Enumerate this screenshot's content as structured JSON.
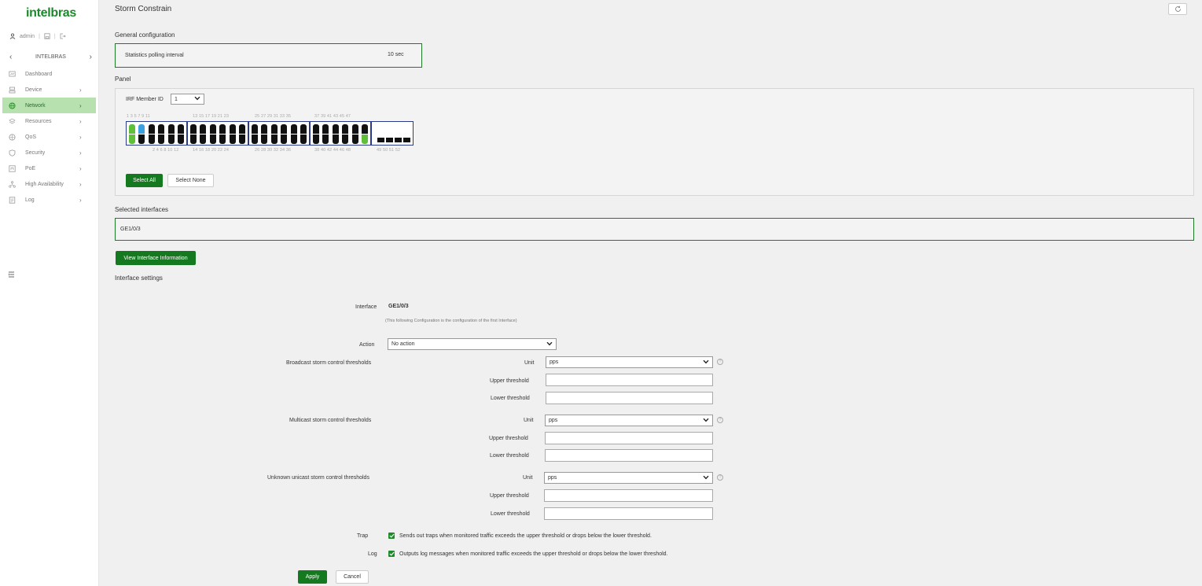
{
  "brand": "intelbras",
  "user": {
    "name": "admin"
  },
  "domain_bar": {
    "left": "‹",
    "label": "INTELBRAS",
    "right": "›"
  },
  "nav": [
    {
      "label": "Dashboard",
      "icon": "dashboard-icon",
      "chevron": ""
    },
    {
      "label": "Device",
      "icon": "device-icon",
      "chevron": "›"
    },
    {
      "label": "Network",
      "icon": "globe-icon",
      "chevron": "›",
      "active": true
    },
    {
      "label": "Resources",
      "icon": "layers-icon",
      "chevron": "›"
    },
    {
      "label": "QoS",
      "icon": "qos-icon",
      "chevron": "›"
    },
    {
      "label": "Security",
      "icon": "shield-icon",
      "chevron": "›"
    },
    {
      "label": "PoE",
      "icon": "poe-icon",
      "chevron": "›"
    },
    {
      "label": "High Availability",
      "icon": "cluster-icon",
      "chevron": "›"
    },
    {
      "label": "Log",
      "icon": "log-icon",
      "chevron": "›"
    }
  ],
  "page": {
    "title": "Storm Constrain",
    "general_title": "General configuration",
    "polling_label": "Statistics polling interval",
    "polling_value": "10 sec",
    "panel_title": "Panel",
    "irf_label": "IRF Member ID",
    "irf_value": "1",
    "port_top_numbers": [
      "1 3 5 7 9 11",
      "13 15 17 19 21 23",
      "25 27 29 31 33 35",
      "37 39 41 43 45 47"
    ],
    "port_bottom_numbers": [
      "2 4 6 8 10 12",
      "14 16 18 20 22 24",
      "26 28 30 32 34 36",
      "38 40 42 44 46 48",
      "49 50 51 52"
    ],
    "select_all": "Select All",
    "select_none": "Select None",
    "selected_title": "Selected interfaces",
    "selected_value": "GE1/0/3",
    "view_info": "View Interface Information",
    "settings_title": "Interface settings",
    "interface_label": "Interface",
    "interface_value": "GE1/0/3",
    "interface_note": "(This following Configuration is the configuration of the first Interface)",
    "action_label": "Action",
    "action_value": "No action",
    "broadcast_label": "Broadcast storm control thresholds",
    "multicast_label": "Multicast storm control thresholds",
    "unknown_label": "Unknown unicast storm control thresholds",
    "unit_label": "Unit",
    "unit_value": "pps",
    "upper_label": "Upper threshold",
    "lower_label": "Lower threshold",
    "trap_label": "Trap",
    "trap_text": "Sends out traps when monitored traffic exceeds the upper threshold or drops below the lower threshold.",
    "log_label": "Log",
    "log_text": "Outputs log messages when monitored traffic exceeds the upper threshold or drops below the lower threshold.",
    "apply": "Apply",
    "cancel": "Cancel"
  },
  "colors": {
    "accent": "#157a1f",
    "active_nav": "#b7e2b0",
    "port_up": "#5fbf3a",
    "port_selected": "#3aa0e0",
    "port_down": "#111111",
    "group_border": "#2b3a8a"
  }
}
